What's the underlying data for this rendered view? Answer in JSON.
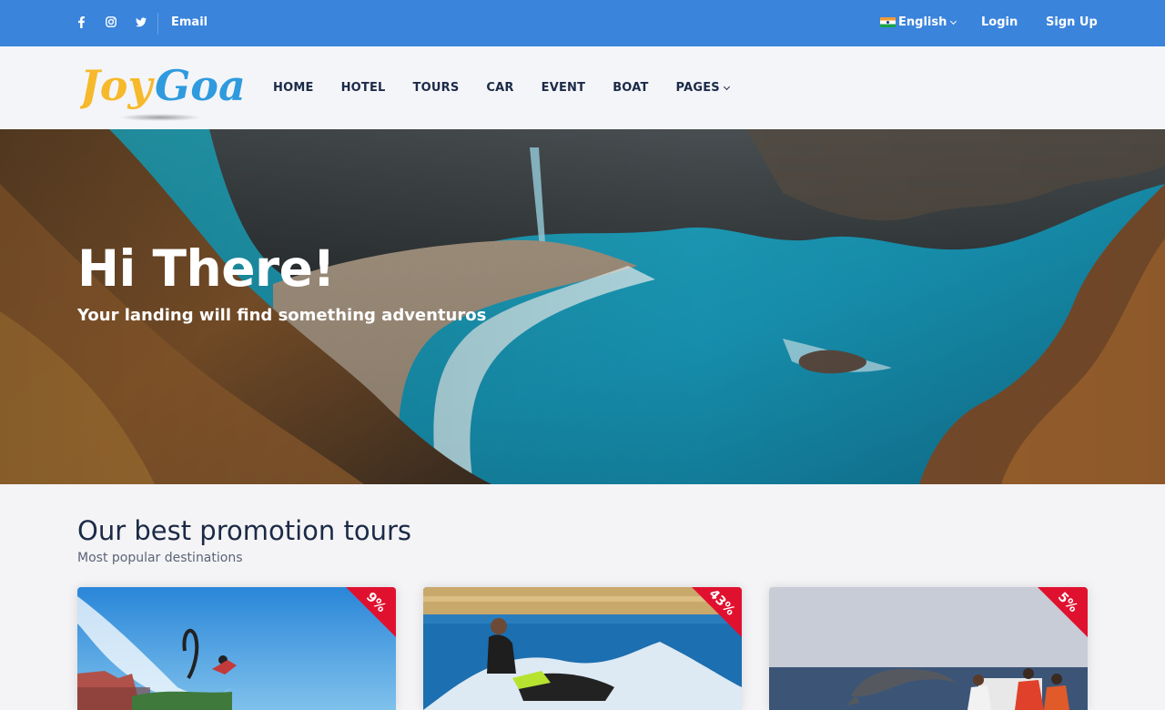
{
  "topbar": {
    "social_icons": [
      "facebook-icon",
      "instagram-icon",
      "twitter-icon"
    ],
    "email_label": "Email",
    "language": "English",
    "login_label": "Login",
    "signup_label": "Sign Up"
  },
  "header": {
    "logo_text_1": "Joy",
    "logo_text_2": "Goa",
    "nav": [
      "HOME",
      "HOTEL",
      "TOURS",
      "CAR",
      "EVENT",
      "BOAT",
      "PAGES"
    ]
  },
  "hero": {
    "title": "Hi There!",
    "subtitle": "Your landing will find something adventuros"
  },
  "promotions": {
    "title": "Our best promotion tours",
    "subtitle": "Most popular destinations",
    "cards": [
      {
        "discount": "9%"
      },
      {
        "discount": "43%"
      },
      {
        "discount": "5%"
      }
    ]
  },
  "colors": {
    "topbar": "#3a84dc",
    "ribbon": "#e0112f",
    "logo_yellow": "#f6b92b",
    "logo_blue": "#2f9bde"
  }
}
